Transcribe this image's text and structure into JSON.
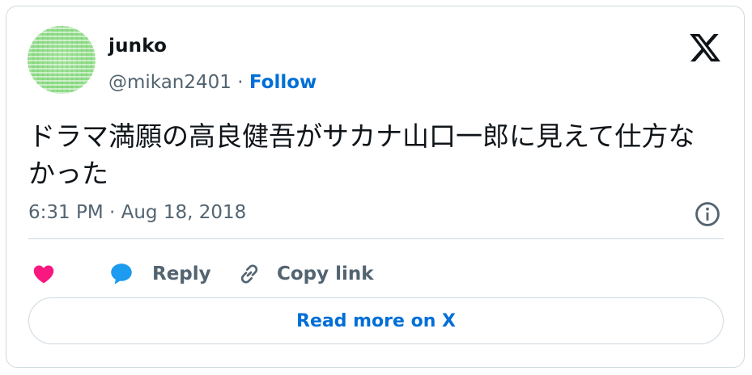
{
  "user": {
    "display_name": "junko",
    "handle": "@mikan2401",
    "separator": " · ",
    "follow_label": "Follow"
  },
  "tweet": {
    "text": "ドラマ満願の高良健吾がサカナ山口一郎に見えて仕方なかった",
    "timestamp": "6:31 PM · Aug 18, 2018"
  },
  "actions": {
    "reply_label": "Reply",
    "copy_link_label": "Copy link",
    "read_more_label": "Read more on X"
  },
  "icons": {
    "logo": "x-logo-icon",
    "info": "info-icon",
    "like": "heart-icon",
    "reply": "reply-bubble-icon",
    "copy_link": "link-icon"
  },
  "colors": {
    "link_blue": "#006fd6",
    "heart_pink": "#f91880",
    "reply_blue": "#1d9bf0",
    "secondary_text": "#536471",
    "border": "#cfd9de"
  }
}
